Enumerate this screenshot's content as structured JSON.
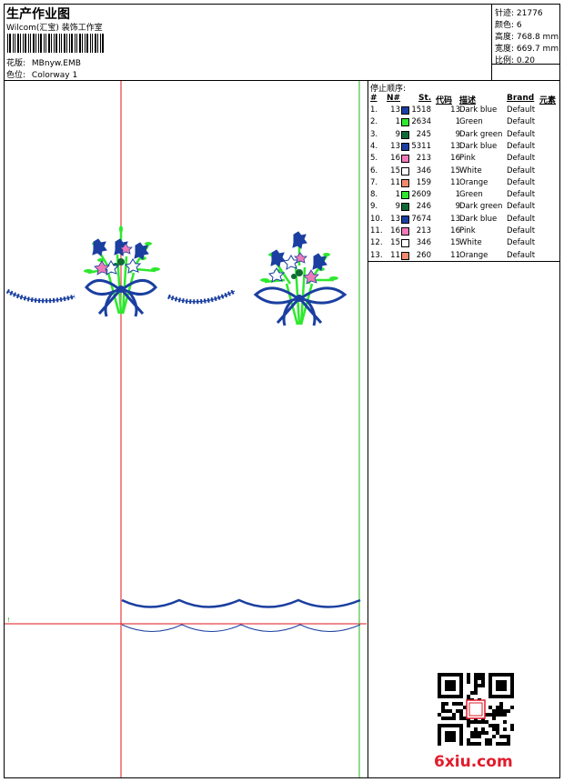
{
  "header": {
    "title": "生产作业图",
    "subtitle": "Wilcom(汇宝) 装饰工作室",
    "design_label": "花版:",
    "design_value": "MBnyw.EMB",
    "colorway_label": "色位:",
    "colorway_value": "Colorway 1"
  },
  "stats": [
    {
      "label": "针迹:",
      "value": "21776"
    },
    {
      "label": "颜色:",
      "value": "6"
    },
    {
      "label": "高度:",
      "value": "768.8 mm"
    },
    {
      "label": "宽度:",
      "value": "669.7 mm"
    },
    {
      "label": "比例:",
      "value": "0.20"
    }
  ],
  "stop_sequence": {
    "title": "停止顺序:",
    "headers": {
      "num": "#",
      "needle": "N#",
      "stitches": "St.",
      "code": "代码",
      "desc": "描述",
      "brand": "Brand",
      "element": "元素"
    },
    "rows": [
      {
        "num": "1.",
        "needle": "13",
        "color": "#1a3fa0",
        "st": "1518",
        "code": "13",
        "desc": "Dark blue",
        "brand": "Default"
      },
      {
        "num": "2.",
        "needle": "1",
        "color": "#2ee82e",
        "st": "2634",
        "code": "1",
        "desc": "Green",
        "brand": "Default"
      },
      {
        "num": "3.",
        "needle": "9",
        "color": "#0f6a36",
        "st": "245",
        "code": "9",
        "desc": "Dark green",
        "brand": "Default"
      },
      {
        "num": "4.",
        "needle": "13",
        "color": "#1a3fa0",
        "st": "5311",
        "code": "13",
        "desc": "Dark blue",
        "brand": "Default"
      },
      {
        "num": "5.",
        "needle": "16",
        "color": "#f07ab8",
        "st": "213",
        "code": "16",
        "desc": "Pink",
        "brand": "Default"
      },
      {
        "num": "6.",
        "needle": "15",
        "color": "#ffffff",
        "st": "346",
        "code": "15",
        "desc": "White",
        "brand": "Default"
      },
      {
        "num": "7.",
        "needle": "11",
        "color": "#f28a6e",
        "st": "159",
        "code": "11",
        "desc": "Orange",
        "brand": "Default"
      },
      {
        "num": "8.",
        "needle": "1",
        "color": "#2ee82e",
        "st": "2609",
        "code": "1",
        "desc": "Green",
        "brand": "Default"
      },
      {
        "num": "9.",
        "needle": "9",
        "color": "#0f6a36",
        "st": "246",
        "code": "9",
        "desc": "Dark green",
        "brand": "Default"
      },
      {
        "num": "10.",
        "needle": "13",
        "color": "#1a3fa0",
        "st": "7674",
        "code": "13",
        "desc": "Dark blue",
        "brand": "Default"
      },
      {
        "num": "11.",
        "needle": "16",
        "color": "#f07ab8",
        "st": "213",
        "code": "16",
        "desc": "Pink",
        "brand": "Default"
      },
      {
        "num": "12.",
        "needle": "15",
        "color": "#ffffff",
        "st": "346",
        "code": "15",
        "desc": "White",
        "brand": "Default"
      },
      {
        "num": "13.",
        "needle": "11",
        "color": "#f28a6e",
        "st": "260",
        "code": "11",
        "desc": "Orange",
        "brand": "Default"
      }
    ]
  },
  "watermark": "6xiu.com",
  "colors": {
    "guide_red": "#e0141e",
    "guide_green": "#22b422",
    "dark_blue": "#1a3fa0",
    "green": "#2ee82e",
    "dark_green": "#0f6a36",
    "pink": "#f07ab8",
    "watermark_red": "#e21b2a"
  }
}
